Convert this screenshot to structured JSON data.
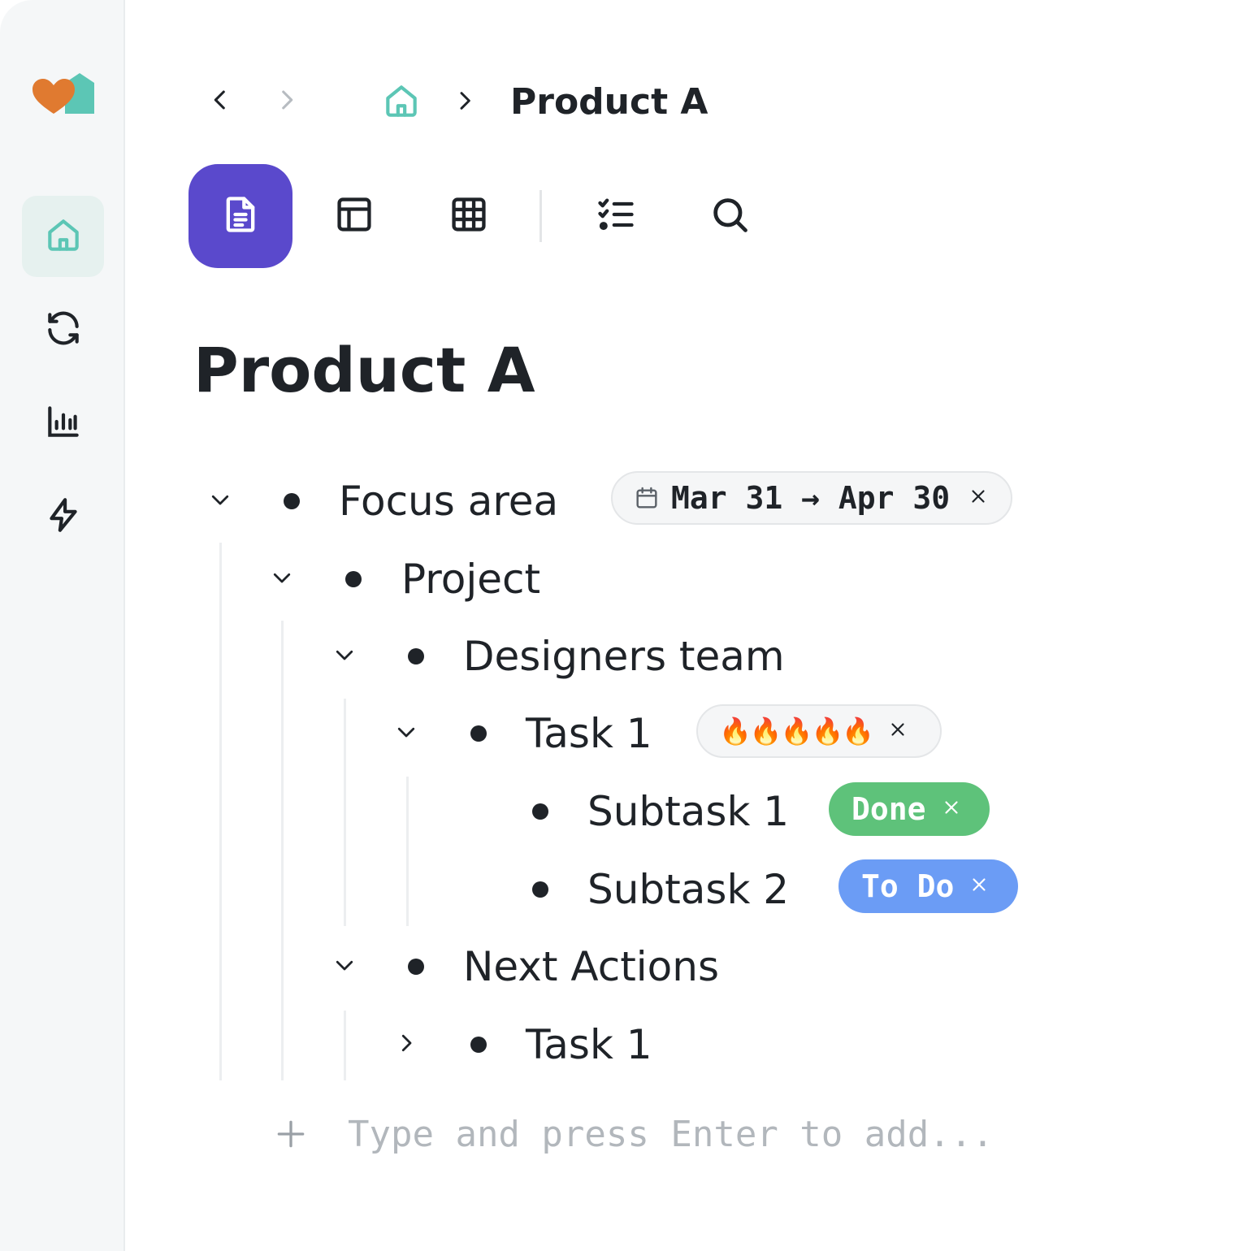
{
  "breadcrumb": {
    "title": "Product A"
  },
  "page": {
    "title": "Product A"
  },
  "sidebar": {
    "items": [
      {
        "icon": "home-icon",
        "active": true
      },
      {
        "icon": "sync-icon",
        "active": false
      },
      {
        "icon": "bar-chart-icon",
        "active": false
      },
      {
        "icon": "lightning-icon",
        "active": false
      }
    ]
  },
  "toolbar": {
    "items": [
      "document-icon",
      "layout-icon",
      "grid-icon",
      "checklist-icon",
      "search-icon"
    ],
    "active": "document-icon"
  },
  "outline": {
    "focus_area": {
      "label": "Focus area",
      "date_chip": "Mar 31 → Apr 30"
    },
    "project": {
      "label": "Project"
    },
    "designers_team": {
      "label": "Designers team"
    },
    "task1": {
      "label": "Task 1",
      "priority_chip": "🔥🔥🔥🔥🔥"
    },
    "subtask1": {
      "label": "Subtask 1",
      "status_chip": "Done"
    },
    "subtask2": {
      "label": "Subtask 2",
      "status_chip": "To Do"
    },
    "next_actions": {
      "label": "Next Actions"
    },
    "next_task1": {
      "label": "Task 1"
    }
  },
  "add_input": {
    "placeholder": "Type and press Enter to add...",
    "value": ""
  },
  "colors": {
    "accent": "#5a49cc",
    "teal": "#5cc6b5",
    "done": "#5ec27a",
    "todo": "#6b9cf5",
    "logo_heart": "#e07a30"
  }
}
